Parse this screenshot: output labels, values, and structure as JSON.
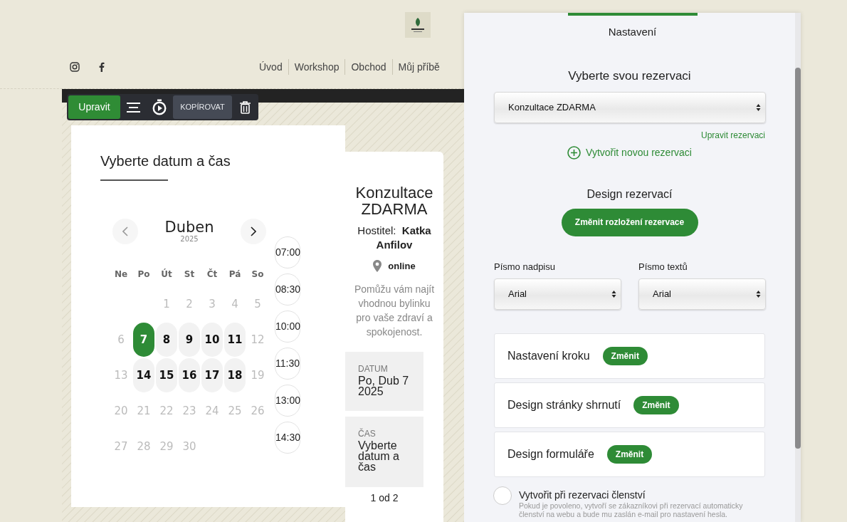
{
  "nav": [
    "Úvod",
    "Workshop",
    "Obchod",
    "Můj příbě"
  ],
  "toolbar": {
    "edit_button": "Upravit",
    "copy_button": "KOPÍROVAT"
  },
  "booking": {
    "title": "Vyberte datum a čas",
    "calendar": {
      "month": "Duben",
      "year": "2025",
      "weekdays": [
        "Ne",
        "Po",
        "Út",
        "St",
        "Čt",
        "Pá",
        "So"
      ],
      "weeks": [
        [
          {
            "label": "1",
            "available": false,
            "selected": false
          },
          {
            "label": "2",
            "available": false,
            "selected": false
          },
          {
            "label": "3",
            "available": false,
            "selected": false
          },
          {
            "label": "4",
            "available": false,
            "selected": false
          },
          {
            "label": "5",
            "available": false,
            "selected": false
          }
        ],
        [
          {
            "label": "6",
            "available": false,
            "selected": false
          },
          {
            "label": "7",
            "available": true,
            "selected": true
          },
          {
            "label": "8",
            "available": true,
            "selected": false
          },
          {
            "label": "9",
            "available": true,
            "selected": false
          },
          {
            "label": "10",
            "available": true,
            "selected": false
          },
          {
            "label": "11",
            "available": true,
            "selected": false
          },
          {
            "label": "12",
            "available": false,
            "selected": false
          }
        ],
        [
          {
            "label": "13",
            "available": false,
            "selected": false
          },
          {
            "label": "14",
            "available": true,
            "selected": false
          },
          {
            "label": "15",
            "available": true,
            "selected": false
          },
          {
            "label": "16",
            "available": true,
            "selected": false
          },
          {
            "label": "17",
            "available": true,
            "selected": false
          },
          {
            "label": "18",
            "available": true,
            "selected": false
          },
          {
            "label": "19",
            "available": false,
            "selected": false
          }
        ],
        [
          {
            "label": "20",
            "available": false,
            "selected": false
          },
          {
            "label": "21",
            "available": false,
            "selected": false
          },
          {
            "label": "22",
            "available": false,
            "selected": false
          },
          {
            "label": "23",
            "available": false,
            "selected": false
          },
          {
            "label": "24",
            "available": false,
            "selected": false
          },
          {
            "label": "25",
            "available": false,
            "selected": false
          },
          {
            "label": "26",
            "available": false,
            "selected": false
          }
        ],
        [
          {
            "label": "27",
            "available": false,
            "selected": false
          },
          {
            "label": "28",
            "available": false,
            "selected": false
          },
          {
            "label": "29",
            "available": false,
            "selected": false
          },
          {
            "label": "30",
            "available": false,
            "selected": false
          }
        ]
      ]
    },
    "times": [
      "07:00",
      "08:30",
      "10:00",
      "11:30",
      "13:00",
      "14:30"
    ]
  },
  "summary": {
    "title": "Konzultace ZDARMA",
    "host_label": "Hostitel:",
    "host_name": "Katka Anfilov",
    "location": "online",
    "description": "Pomůžu vám najít vhodnou bylinku pro vaše zdraví a spokojenost.",
    "date_label": "DATUM",
    "date_value": "Po, Dub 7 2025",
    "time_label": "ČAS",
    "time_value": "Vyberte datum a čas",
    "pager": "1 od 2"
  },
  "panel": {
    "tab": "Nastavení",
    "select_heading": "Vyberte svou rezervaci",
    "selected_booking": "Konzultace ZDARMA",
    "edit_link": "Upravit rezervaci",
    "create_link": "Vytvořit novou rezervaci",
    "design_heading": "Design rezervací",
    "layout_button": "Změnit rozložení rezervace",
    "heading_font_label": "Písmo nadpisu",
    "heading_font": "Arial",
    "text_font_label": "Písmo textů",
    "text_font": "Arial",
    "sections": [
      {
        "title": "Nastavení kroku",
        "button": "Změnit"
      },
      {
        "title": "Design stránky shrnutí",
        "button": "Změnit"
      },
      {
        "title": "Design formuláře",
        "button": "Změnit"
      }
    ],
    "membership": {
      "label": "Vytvořit při rezervaci členství",
      "hint": "Pokud je povoleno, vytvoří se zákazníkovi při rezervací automaticky členství na webu a bude mu zaslán e-mail pro nastavení hesla.",
      "checked": false
    }
  }
}
